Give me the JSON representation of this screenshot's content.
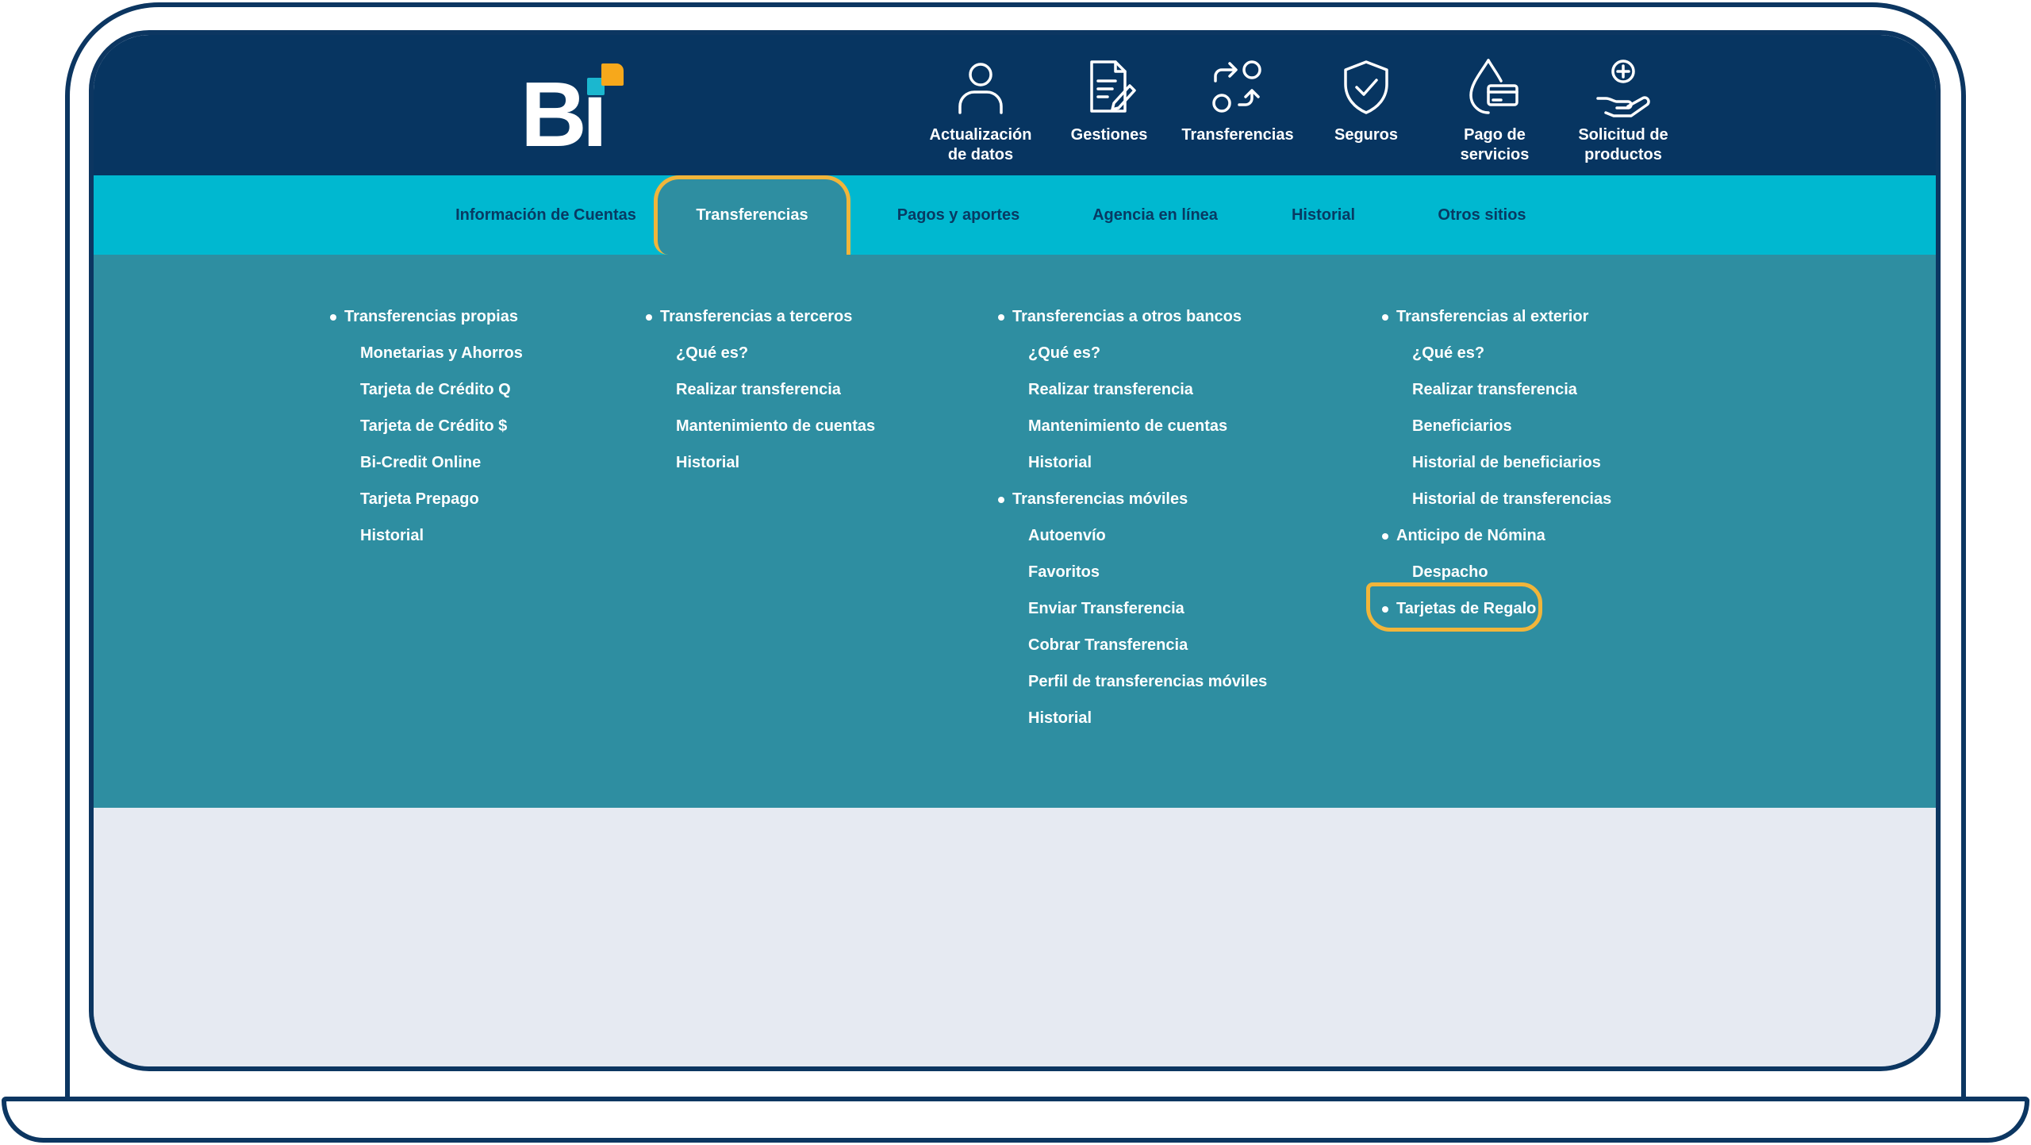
{
  "brand": {
    "logo_text": "Bi"
  },
  "quick_actions": [
    {
      "label": "Actualización\nde datos",
      "icon": "user-icon"
    },
    {
      "label": "Gestiones",
      "icon": "document-edit-icon"
    },
    {
      "label": "Transferencias",
      "icon": "transfer-icon"
    },
    {
      "label": "Seguros",
      "icon": "shield-check-icon"
    },
    {
      "label": "Pago de\nservicios",
      "icon": "utility-payment-icon"
    },
    {
      "label": "Solicitud de\nproductos",
      "icon": "hand-plus-icon"
    }
  ],
  "nav": {
    "items": [
      {
        "label": "Información de Cuentas"
      },
      {
        "label": "Transferencias",
        "active": true
      },
      {
        "label": "Pagos y aportes"
      },
      {
        "label": "Agencia en línea"
      },
      {
        "label": "Historial"
      },
      {
        "label": "Otros sitios"
      }
    ]
  },
  "menu": {
    "col1": {
      "head": "Transferencias propias",
      "items": [
        "Monetarias y Ahorros",
        "Tarjeta de Crédito Q",
        "Tarjeta de Crédito $",
        "Bi-Credit Online",
        "Tarjeta Prepago",
        "Historial"
      ]
    },
    "col2": {
      "head": "Transferencias a terceros",
      "items": [
        "¿Qué es?",
        "Realizar transferencia",
        "Mantenimiento de cuentas",
        "Historial"
      ]
    },
    "col3": {
      "head1": "Transferencias a otros bancos",
      "items1": [
        "¿Qué es?",
        "Realizar transferencia",
        "Mantenimiento de cuentas",
        "Historial"
      ],
      "head2": "Transferencias móviles",
      "items2": [
        "Autoenvío",
        "Favoritos",
        "Enviar Transferencia",
        "Cobrar Transferencia",
        "Perfil de transferencias móviles",
        "Historial"
      ]
    },
    "col4": {
      "head1": "Transferencias al exterior",
      "items1": [
        "¿Qué es?",
        "Realizar transferencia",
        "Beneficiarios",
        "Historial de beneficiarios",
        "Historial de transferencias"
      ],
      "head2": "Anticipo de Nómina",
      "items2": [
        "Despacho"
      ],
      "head3": "Tarjetas de Regalo"
    }
  },
  "colors": {
    "header": "#073561",
    "nav": "#00b8d0",
    "menu": "#2e8ea1",
    "highlight": "#f1b53a",
    "frame": "#0c3661"
  }
}
